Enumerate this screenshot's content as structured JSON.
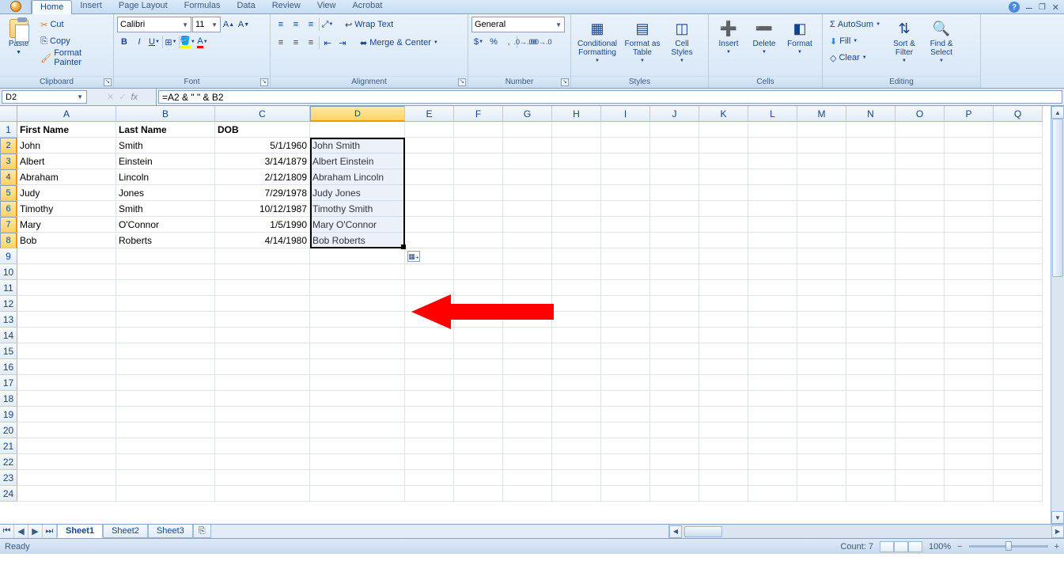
{
  "tabs": [
    "Home",
    "Insert",
    "Page Layout",
    "Formulas",
    "Data",
    "Review",
    "View",
    "Acrobat"
  ],
  "activeTab": "Home",
  "clipboard": {
    "paste": "Paste",
    "cut": "Cut",
    "copy": "Copy",
    "formatPainter": "Format Painter",
    "title": "Clipboard"
  },
  "font": {
    "name": "Calibri",
    "size": "11",
    "title": "Font"
  },
  "alignment": {
    "wrap": "Wrap Text",
    "merge": "Merge & Center",
    "title": "Alignment"
  },
  "number": {
    "format": "General",
    "title": "Number"
  },
  "styles": {
    "cond": "Conditional Formatting",
    "fmt": "Format as Table",
    "cell": "Cell Styles",
    "title": "Styles"
  },
  "cells": {
    "insert": "Insert",
    "delete": "Delete",
    "format": "Format",
    "title": "Cells"
  },
  "editing": {
    "autosum": "AutoSum",
    "fill": "Fill",
    "clear": "Clear",
    "sort": "Sort & Filter",
    "find": "Find & Select",
    "title": "Editing"
  },
  "nameBox": "D2",
  "formula": "=A2 & \" \" & B2",
  "fx": "fx",
  "columns": [
    "A",
    "B",
    "C",
    "D",
    "E",
    "F",
    "G",
    "H",
    "I",
    "J",
    "K",
    "L",
    "M",
    "N",
    "O",
    "P",
    "Q"
  ],
  "headers": {
    "A": "First Name",
    "B": "Last Name",
    "C": "DOB"
  },
  "rows": [
    {
      "A": "John",
      "B": "Smith",
      "C": "5/1/1960",
      "D": "John Smith"
    },
    {
      "A": "Albert",
      "B": "Einstein",
      "C": "3/14/1879",
      "D": "Albert Einstein"
    },
    {
      "A": "Abraham",
      "B": "Lincoln",
      "C": "2/12/1809",
      "D": "Abraham Lincoln"
    },
    {
      "A": "Judy",
      "B": "Jones",
      "C": "7/29/1978",
      "D": "Judy Jones"
    },
    {
      "A": "Timothy",
      "B": "Smith",
      "C": "10/12/1987",
      "D": "Timothy Smith"
    },
    {
      "A": "Mary",
      "B": "O'Connor",
      "C": "1/5/1990",
      "D": "Mary O'Connor"
    },
    {
      "A": "Bob",
      "B": "Roberts",
      "C": "4/14/1980",
      "D": "Bob Roberts"
    }
  ],
  "totalRows": 24,
  "sheets": [
    "Sheet1",
    "Sheet2",
    "Sheet3"
  ],
  "activeSheet": "Sheet1",
  "status": {
    "ready": "Ready",
    "count": "Count: 7",
    "zoom": "100%"
  },
  "selection": {
    "col": "D",
    "startRow": 2,
    "endRow": 8
  }
}
